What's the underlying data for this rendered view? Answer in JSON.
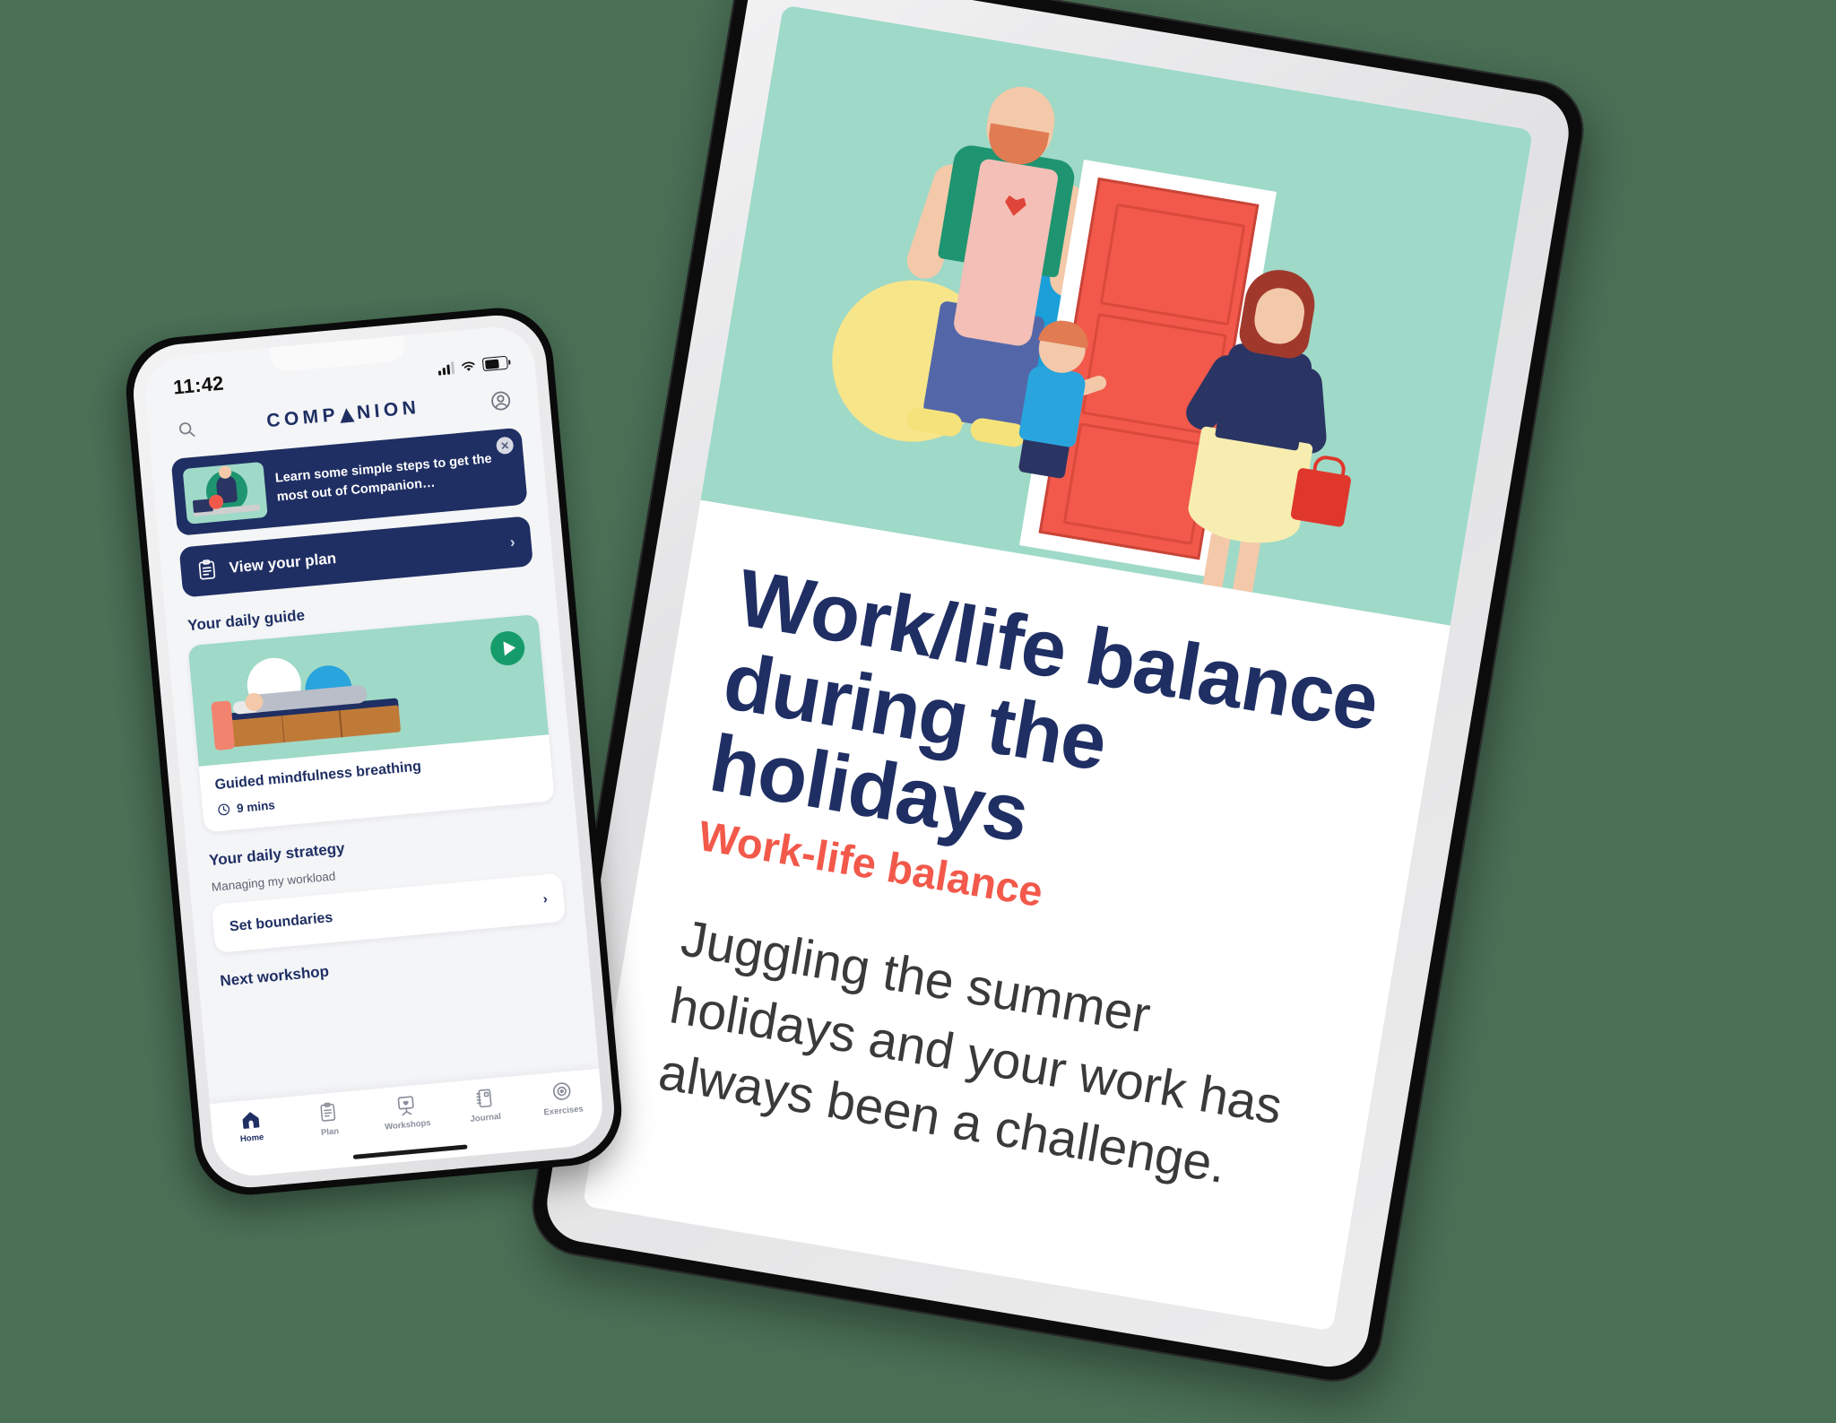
{
  "background_color": "#4a7056",
  "phone": {
    "status_bar": {
      "time": "11:42",
      "signal_icon": "cellular-signal-icon",
      "wifi_icon": "wifi-icon",
      "battery_icon": "battery-icon"
    },
    "app_bar": {
      "search_icon": "search-icon",
      "brand_part1": "COMP",
      "brand_part2": "NION",
      "brand_full": "COMPANION",
      "profile_icon": "account-circle-icon"
    },
    "promo_banner": {
      "text": "Learn some simple steps to get the most out of Companion…",
      "close_icon": "close-icon",
      "thumbnail_icon": "onboarding-thumbnail",
      "background_color": "#1f2f63"
    },
    "plan_button": {
      "label": "View your plan",
      "icon": "clipboard-icon",
      "chevron": "›"
    },
    "daily_guide": {
      "heading": "Your daily guide",
      "card": {
        "title": "Guided mindfulness breathing",
        "duration": "9 mins",
        "clock_icon": "clock-icon",
        "play_icon": "play-icon",
        "media_alt": "person-lying-on-bed-illustration"
      }
    },
    "daily_strategy": {
      "heading": "Your daily strategy",
      "subtitle": "Managing my workload",
      "row": {
        "label": "Set boundaries",
        "chevron": "›"
      }
    },
    "next_workshop": {
      "heading": "Next workshop"
    },
    "tab_bar": [
      {
        "label": "Home",
        "icon": "home-icon",
        "active": true
      },
      {
        "label": "Plan",
        "icon": "clipboard-list-icon",
        "active": false
      },
      {
        "label": "Workshops",
        "icon": "easel-heart-icon",
        "active": false
      },
      {
        "label": "Journal",
        "icon": "notebook-icon",
        "active": false
      },
      {
        "label": "Exercises",
        "icon": "target-icon",
        "active": false
      }
    ]
  },
  "tablet": {
    "hero_alt": "family-at-front-door-illustration",
    "article": {
      "title": "Work/life balance during the holidays",
      "category": "Work-life balance",
      "category_color": "#f2594b",
      "body": "Juggling the summer holidays and your work has always been a challenge."
    }
  }
}
